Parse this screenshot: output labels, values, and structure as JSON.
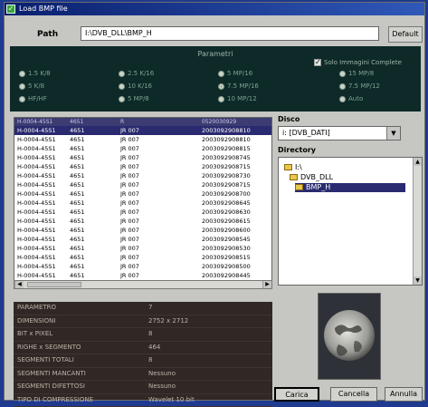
{
  "window": {
    "title": "Load BMP file"
  },
  "path": {
    "label": "Path",
    "value": "I:\\DVB_DLL\\BMP_H",
    "default_button": "Default"
  },
  "parameters": {
    "title": "Parametri",
    "options": [
      {
        "label": "1.5 K/8",
        "selected": false
      },
      {
        "label": "5 K/8",
        "selected": false
      },
      {
        "label": "HF/HF",
        "selected": false
      },
      {
        "label": "2.5 K/16",
        "selected": false
      },
      {
        "label": "10 K/16",
        "selected": false
      },
      {
        "label": "5 MP/8",
        "selected": false
      },
      {
        "label": "5 MP/16",
        "selected": false
      },
      {
        "label": "7.5 MP/16",
        "selected": true
      },
      {
        "label": "10 MP/12",
        "selected": false
      },
      {
        "label": "15 MP/8",
        "selected": false
      },
      {
        "label": "7.5 MP/12",
        "selected": false
      },
      {
        "label": "Auto",
        "selected": false
      }
    ],
    "checkbox": {
      "label": "Solo Immagini Complete",
      "checked": true
    }
  },
  "file_list": {
    "headers": [
      "H-0004-45S1",
      "4651",
      "R",
      "0520030929"
    ],
    "rows": [
      {
        "name": "H-0004-45S1",
        "code": "4651",
        "ext": "JR 007",
        "date": "2003092908810",
        "selected": true
      },
      {
        "name": "H-0004-45S1",
        "code": "4651",
        "ext": "JR 007",
        "date": "2003092908810",
        "selected": false
      },
      {
        "name": "H-0004-45S1",
        "code": "4651",
        "ext": "JR 007",
        "date": "2003092908815",
        "selected": false
      },
      {
        "name": "H-0004-45S1",
        "code": "4651",
        "ext": "JR 007",
        "date": "2003092908745",
        "selected": false
      },
      {
        "name": "H-0004-45S1",
        "code": "4651",
        "ext": "JR 007",
        "date": "2003092908715",
        "selected": false
      },
      {
        "name": "H-0004-45S1",
        "code": "4651",
        "ext": "JR 007",
        "date": "2003092908730",
        "selected": false
      },
      {
        "name": "H-0004-45S1",
        "code": "4651",
        "ext": "JR 007",
        "date": "2003092908715",
        "selected": false
      },
      {
        "name": "H-0004-45S1",
        "code": "4651",
        "ext": "JR 007",
        "date": "2003092908700",
        "selected": false
      },
      {
        "name": "H-0004-45S1",
        "code": "4651",
        "ext": "JR 007",
        "date": "2003092908645",
        "selected": false
      },
      {
        "name": "H-0004-45S1",
        "code": "4651",
        "ext": "JR 007",
        "date": "2003092908630",
        "selected": false
      },
      {
        "name": "H-0004-45S1",
        "code": "4651",
        "ext": "JR 007",
        "date": "2003092908615",
        "selected": false
      },
      {
        "name": "H-0004-45S1",
        "code": "4651",
        "ext": "JR 007",
        "date": "2003092908600",
        "selected": false
      },
      {
        "name": "H-0004-45S1",
        "code": "4651",
        "ext": "JR 007",
        "date": "2003092908545",
        "selected": false
      },
      {
        "name": "H-0004-45S1",
        "code": "4651",
        "ext": "JR 007",
        "date": "2003092908530",
        "selected": false
      },
      {
        "name": "H-0004-45S1",
        "code": "4651",
        "ext": "JR 007",
        "date": "2003092908515",
        "selected": false
      },
      {
        "name": "H-0004-45S1",
        "code": "4651",
        "ext": "JR 007",
        "date": "2003092908500",
        "selected": false
      },
      {
        "name": "H-0004-45S1",
        "code": "4651",
        "ext": "JR 007",
        "date": "2003092908445",
        "selected": false
      },
      {
        "name": "H-0004-45S1",
        "code": "4651",
        "ext": "JR 007",
        "date": "2003092908100",
        "selected": false
      }
    ]
  },
  "drive": {
    "label": "Disco",
    "value": "i: [DVB_DATI]"
  },
  "directory": {
    "label": "Directory",
    "items": [
      {
        "label": "I:\\",
        "selected": false
      },
      {
        "label": "DVB_DLL",
        "selected": false
      },
      {
        "label": "BMP_H",
        "selected": true
      }
    ]
  },
  "info": {
    "rows": [
      {
        "key": "PARAMETRO",
        "value": "7"
      },
      {
        "key": "DIMENSIONI",
        "value": "2752 x 2712"
      },
      {
        "key": "BIT x PIXEL",
        "value": "8"
      },
      {
        "key": "RIGHE x SEGMENTO",
        "value": "464"
      },
      {
        "key": "SEGMENTI TOTALI",
        "value": "8"
      },
      {
        "key": "SEGMENTI MANCANTI",
        "value": "Nessuno"
      },
      {
        "key": "SEGMENTI DIFETTOSI",
        "value": "Nessuno"
      },
      {
        "key": "TIPO DI COMPRESSIONE",
        "value": "Wavelet 10 bit"
      }
    ]
  },
  "buttons": {
    "load": "Carica",
    "delete": "Cancella",
    "cancel": "Annulla"
  }
}
